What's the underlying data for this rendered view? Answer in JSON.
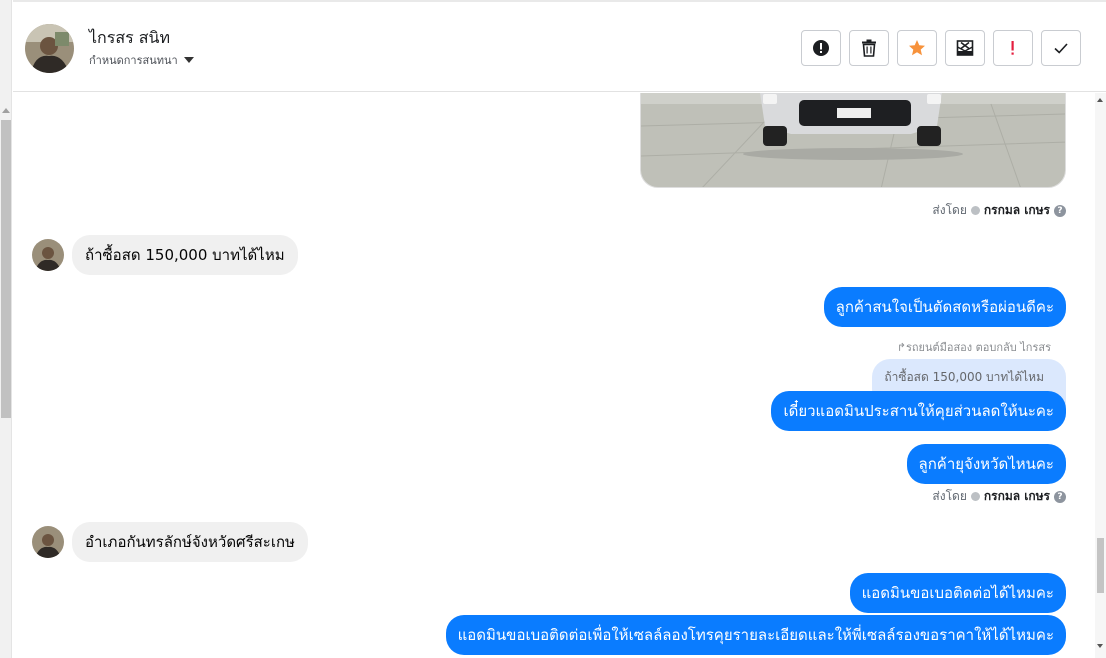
{
  "conversation": {
    "contact_name": "ไกรสร สนิท",
    "subtitle": "กำหนดการสนทนา"
  },
  "toolbar": {
    "buttons": [
      {
        "icon": "exclamation-circle-icon",
        "color": "#1c1e21"
      },
      {
        "icon": "trash-icon",
        "color": "#1c1e21"
      },
      {
        "icon": "star-icon",
        "color": "#f7923b"
      },
      {
        "icon": "mail-x-icon",
        "color": "#1c1e21"
      },
      {
        "icon": "exclamation-icon",
        "color": "#e41e3f"
      },
      {
        "icon": "check-icon",
        "color": "#1c1e21"
      }
    ]
  },
  "messages": {
    "sent_by_prefix": "ส่งโดย",
    "sent_by_name": "กรกมล เกษร",
    "incoming_1": "ถ้าซื้อสด 150,000 บาทได้ไหม",
    "outgoing_1": "ลูกค้าสนใจเป็นตัดสดหรือผ่อนดีคะ",
    "reply_meta": "รถยนต์มือสอง ตอบกลับ ไกรสร",
    "reply_quote": "ถ้าซื้อสด 150,000 บาทได้ไหม",
    "outgoing_2": "เดี๋ยวแอดมินประสานให้คุยส่วนลดให้นะคะ",
    "outgoing_3": "ลูกค้ายุจังหวัดไหนคะ",
    "incoming_2": "อำเภอกันทรลักษ์จังหวัดศรีสะเกษ",
    "outgoing_4": "แอดมินขอเบอติดต่อได้ไหมคะ",
    "outgoing_5": "แอดมินขอเบอติดต่อเพื่อให้เซลล์ลองโทรคุยรายละเอียดและให้พี่เซลล์รองขอราคาให้ได้ไหมคะ"
  },
  "colors": {
    "outgoing_bubble": "#0a7cff",
    "incoming_bubble": "#f0f0f0",
    "reply_bubble": "#dbe8fd"
  }
}
